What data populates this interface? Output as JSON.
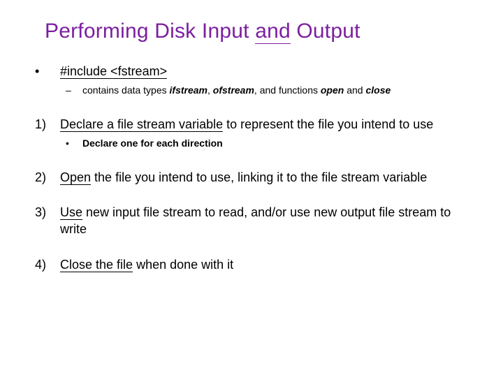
{
  "title": {
    "pre": "Performing Disk Input ",
    "u": "and",
    "post": " Output"
  },
  "items": [
    {
      "marker": "•",
      "runs": [
        {
          "u": true,
          "text": "#include <fstream>"
        }
      ],
      "sub": {
        "marker": "–",
        "runs": [
          {
            "text": "contains data types "
          },
          {
            "ital": true,
            "text": "ifstream"
          },
          {
            "text": ", "
          },
          {
            "ital": true,
            "text": "ofstream"
          },
          {
            "text": ", and functions "
          },
          {
            "ital": true,
            "text": "open"
          },
          {
            "text": " and "
          },
          {
            "ital": true,
            "text": "close"
          }
        ]
      }
    },
    {
      "marker": "1)",
      "runs": [
        {
          "u": true,
          "text": "Declare a file stream variable"
        },
        {
          "text": " to represent the file you intend to use"
        }
      ],
      "sub": {
        "marker": "•",
        "runs": [
          {
            "bold": true,
            "text": "Declare one for each direction"
          }
        ]
      }
    },
    {
      "marker": "2)",
      "runs": [
        {
          "u": true,
          "text": "Open"
        },
        {
          "text": " the file you intend to use, linking it to the file stream variable"
        }
      ]
    },
    {
      "marker": "3)",
      "runs": [
        {
          "u": true,
          "text": "Use"
        },
        {
          "text": " new input file stream to read, and/or use new output file stream to write"
        }
      ]
    },
    {
      "marker": "4)",
      "runs": [
        {
          "u": true,
          "text": "Close the file"
        },
        {
          "text": " when done with it"
        }
      ]
    }
  ]
}
